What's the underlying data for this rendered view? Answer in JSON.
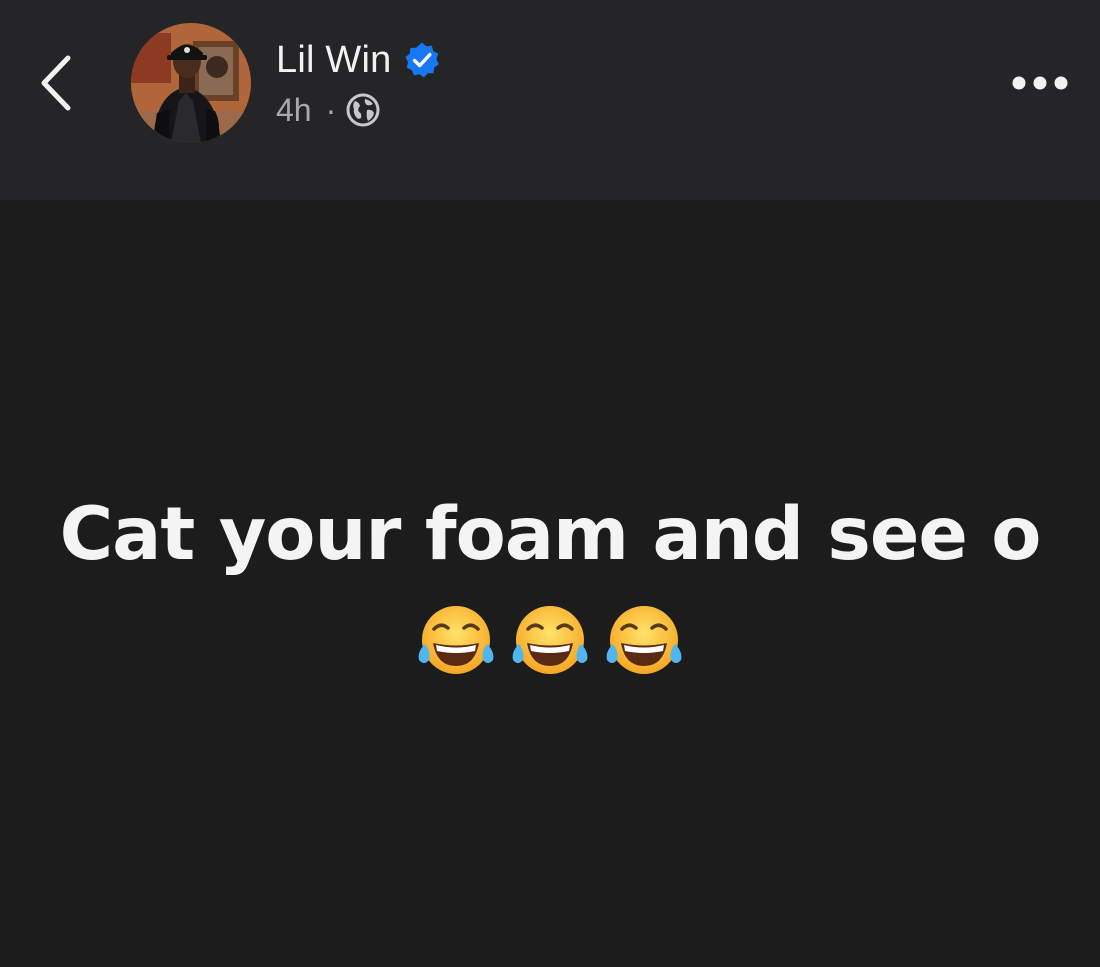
{
  "header": {
    "author_name": "Lil Win",
    "verified": true,
    "time": "4h",
    "separator": "·",
    "audience_icon": "globe-icon",
    "back_icon": "chevron-left-icon",
    "more_icon": "more-horizontal-icon",
    "verified_color": "#1877f2"
  },
  "post": {
    "text": "Cat your foam and see o",
    "emojis": [
      "face-with-tears-of-joy",
      "face-with-tears-of-joy",
      "face-with-tears-of-joy"
    ]
  },
  "colors": {
    "header_bg": "#252528",
    "body_bg": "#1c1c1d",
    "text_primary": "#f4f4f4",
    "text_secondary": "#a8a8ad"
  }
}
